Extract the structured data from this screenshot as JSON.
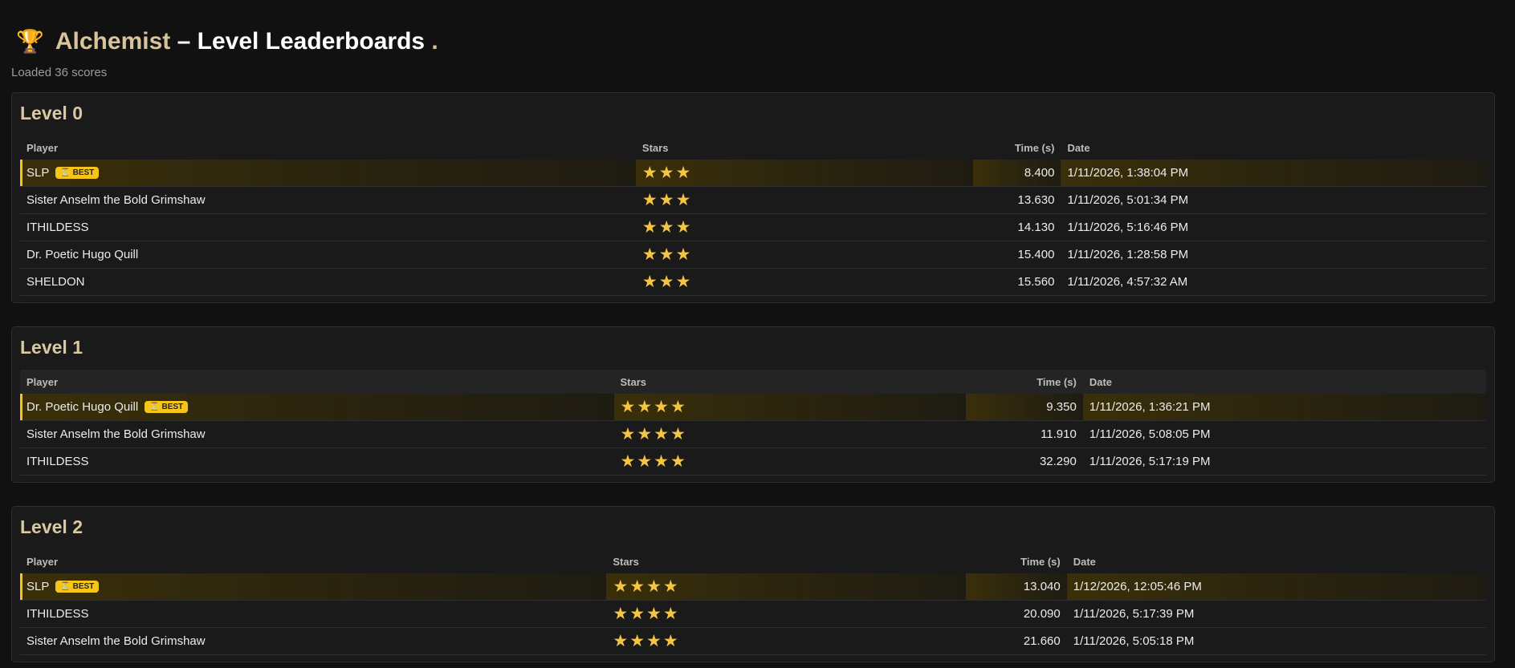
{
  "header": {
    "trophy_icon": "🏆",
    "brand": "Alchemist",
    "separator": " – ",
    "title": "Level Leaderboards",
    "dot": " ."
  },
  "status": "Loaded 36 scores",
  "columns": {
    "player": "Player",
    "stars": "Stars",
    "time": "Time (s)",
    "date": "Date"
  },
  "badge_label": "BEST",
  "badge_icon": "⏳",
  "levels": [
    {
      "title": "Level 0",
      "rows": [
        {
          "player": "SLP",
          "stars": "★★★",
          "time": "8.400",
          "date": "1/11/2026, 1:38:04 PM"
        },
        {
          "player": "Sister Anselm the Bold Grimshaw",
          "stars": "★★★",
          "time": "13.630",
          "date": "1/11/2026, 5:01:34 PM"
        },
        {
          "player": "ITHILDESS",
          "stars": "★★★",
          "time": "14.130",
          "date": "1/11/2026, 5:16:46 PM"
        },
        {
          "player": "Dr. Poetic Hugo Quill",
          "stars": "★★★",
          "time": "15.400",
          "date": "1/11/2026, 1:28:58 PM"
        },
        {
          "player": "SHELDON",
          "stars": "★★★",
          "time": "15.560",
          "date": "1/11/2026, 4:57:32 AM"
        }
      ]
    },
    {
      "title": "Level 1",
      "rows": [
        {
          "player": "Dr. Poetic Hugo Quill",
          "stars": "★★★★",
          "time": "9.350",
          "date": "1/11/2026, 1:36:21 PM"
        },
        {
          "player": "Sister Anselm the Bold Grimshaw",
          "stars": "★★★★",
          "time": "11.910",
          "date": "1/11/2026, 5:08:05 PM"
        },
        {
          "player": "ITHILDESS",
          "stars": "★★★★",
          "time": "32.290",
          "date": "1/11/2026, 5:17:19 PM"
        }
      ]
    },
    {
      "title": "Level 2",
      "rows": [
        {
          "player": "SLP",
          "stars": "★★★★",
          "time": "13.040",
          "date": "1/12/2026, 12:05:46 PM"
        },
        {
          "player": "ITHILDESS",
          "stars": "★★★★",
          "time": "20.090",
          "date": "1/11/2026, 5:17:39 PM"
        },
        {
          "player": "Sister Anselm the Bold Grimshaw",
          "stars": "★★★★",
          "time": "21.660",
          "date": "1/11/2026, 5:05:18 PM"
        }
      ]
    }
  ]
}
